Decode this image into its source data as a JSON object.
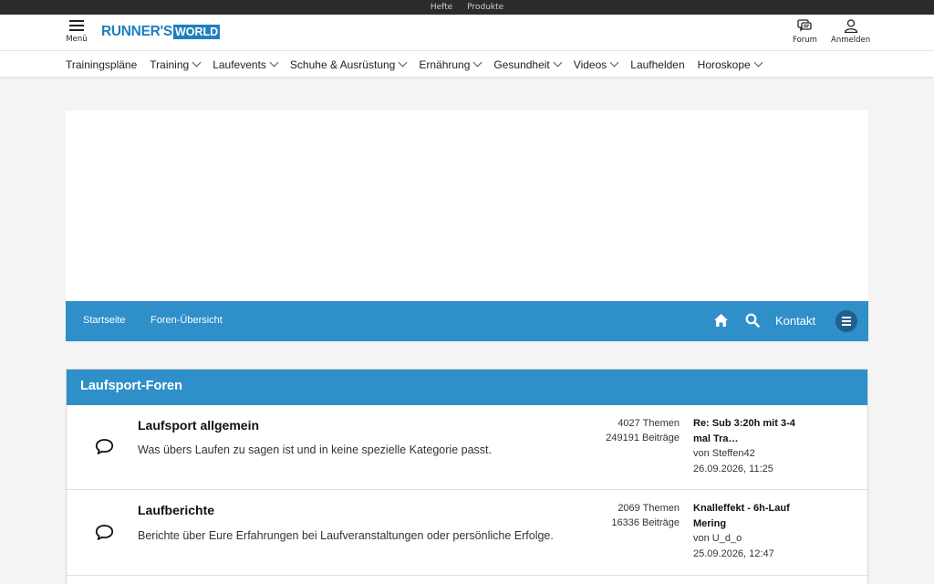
{
  "topbar": {
    "links": [
      "Hefte",
      "Produkte"
    ]
  },
  "header": {
    "menu_label": "Menü",
    "logo_part1": "RUNNER'S",
    "logo_part2": "WORLD",
    "forum_label": "Forum",
    "login_label": "Anmelden"
  },
  "nav": {
    "items": [
      {
        "label": "Trainingspläne",
        "has_dropdown": false
      },
      {
        "label": "Training",
        "has_dropdown": true
      },
      {
        "label": "Laufevents",
        "has_dropdown": true
      },
      {
        "label": "Schuhe & Ausrüstung",
        "has_dropdown": true
      },
      {
        "label": "Ernährung",
        "has_dropdown": true
      },
      {
        "label": "Gesundheit",
        "has_dropdown": true
      },
      {
        "label": "Videos",
        "has_dropdown": true
      },
      {
        "label": "Laufhelden",
        "has_dropdown": false
      },
      {
        "label": "Horoskope",
        "has_dropdown": true
      }
    ]
  },
  "forum_nav": {
    "home_crumb": "Startseite",
    "index_crumb": "Foren-Übersicht",
    "contact_label": "Kontakt"
  },
  "category": {
    "title": "Laufsport-Foren",
    "forums": [
      {
        "title": "Laufsport allgemein",
        "description": "Was übers Laufen zu sagen ist und in keine spezielle Kategorie passt.",
        "topics": "4027 Themen",
        "posts": "249191 Beiträge",
        "last_post_title": "Re: Sub 3:20h mit 3-4 mal Tra…",
        "last_post_by": "von Steffen42",
        "last_post_date": "26.09.2026, 11:25"
      },
      {
        "title": "Laufberichte",
        "description": "Berichte über Eure Erfahrungen bei Laufveranstaltungen oder persönliche Erfolge.",
        "topics": "2069 Themen",
        "posts": "16336 Beiträge",
        "last_post_title": "Knalleffekt - 6h-Lauf Mering",
        "last_post_by": "von U_d_o",
        "last_post_date": "25.09.2026, 12:47"
      }
    ]
  },
  "colors": {
    "brand_blue": "#2e8fc9",
    "logo_blue": "#1f7fbf",
    "topbar": "#2b2b2b"
  }
}
